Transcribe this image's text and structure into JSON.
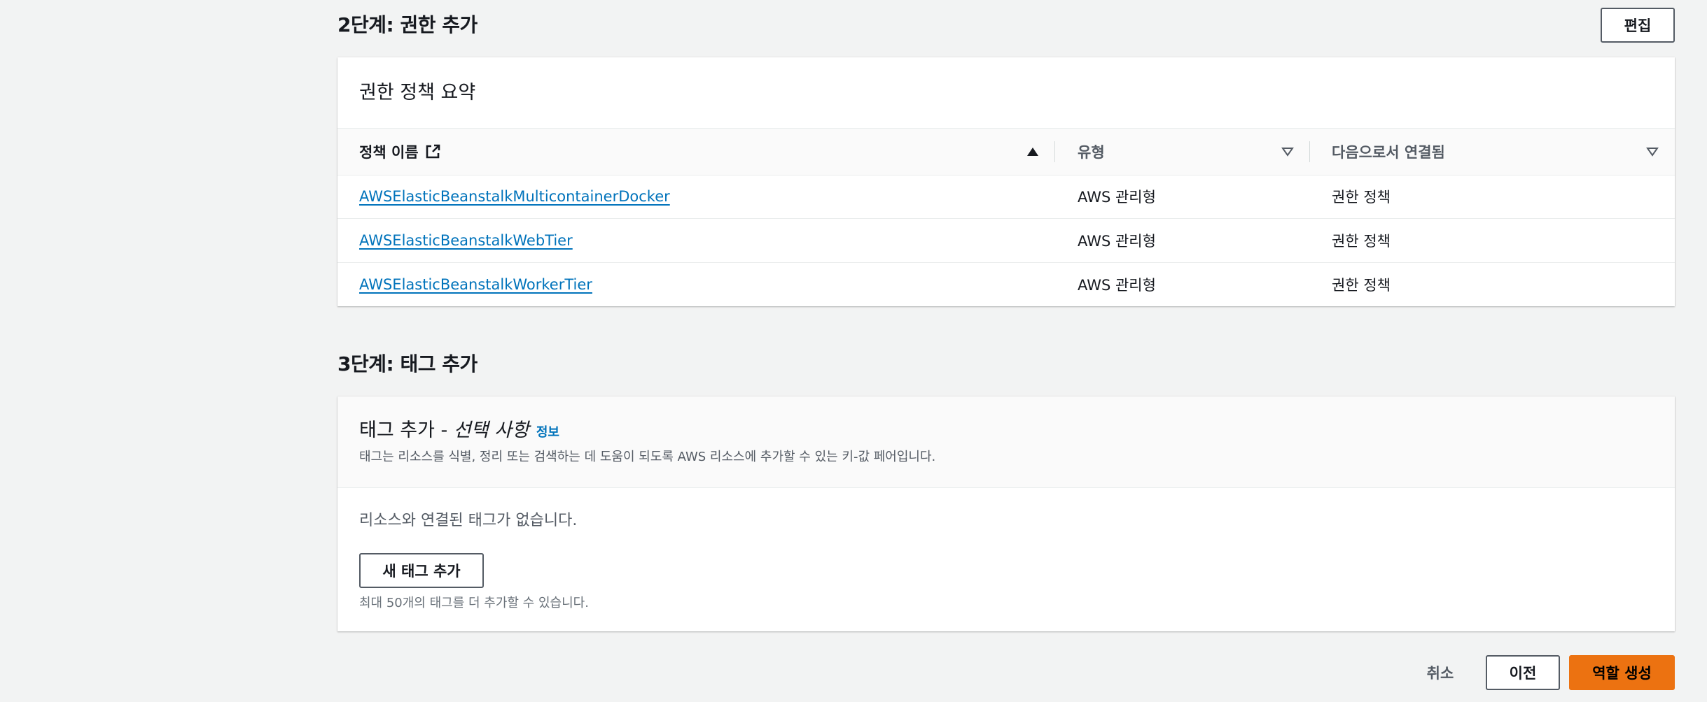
{
  "step2": {
    "title": "2단계: 권한 추가",
    "edit_label": "편집",
    "panel_title": "권한 정책 요약",
    "columns": {
      "name": "정책 이름",
      "type": "유형",
      "attached_as": "다음으로서 연결됨"
    },
    "rows": [
      {
        "name": "AWSElasticBeanstalkMulticontainerDocker",
        "type": "AWS 관리형",
        "attached_as": "권한 정책"
      },
      {
        "name": "AWSElasticBeanstalkWebTier",
        "type": "AWS 관리형",
        "attached_as": "권한 정책"
      },
      {
        "name": "AWSElasticBeanstalkWorkerTier",
        "type": "AWS 관리형",
        "attached_as": "권한 정책"
      }
    ]
  },
  "step3": {
    "title": "3단계: 태그 추가",
    "panel_title": "태그 추가 - ",
    "panel_title_optional": "선택 사항",
    "info_label": "정보",
    "description": "태그는 리소스를 식별, 정리 또는 검색하는 데 도움이 되도록 AWS 리소스에 추가할 수 있는 키-값 페어입니다.",
    "empty_text": "리소스와 연결된 태그가 없습니다.",
    "add_tag_label": "새 태그 추가",
    "limit_hint": "최대 50개의 태그를 더 추가할 수 있습니다."
  },
  "footer": {
    "cancel_label": "취소",
    "previous_label": "이전",
    "create_label": "역할 생성"
  },
  "colors": {
    "link": "#0073bb",
    "primary": "#ec7211",
    "background": "#f2f3f3"
  },
  "icons": {
    "external_link": "external-link-icon",
    "sort_ascending": "caret-up-filled-icon",
    "sort_none": "caret-down-outline-icon"
  }
}
